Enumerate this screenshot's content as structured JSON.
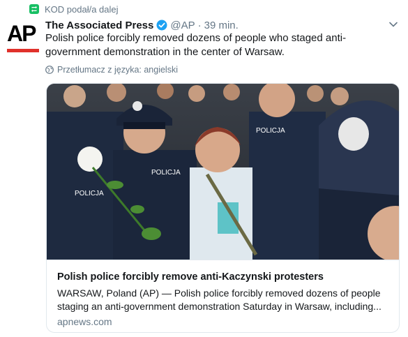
{
  "retweet": {
    "label": "KOD podał/a dalej",
    "icon": "retweet-icon",
    "color": "#17bf63"
  },
  "tweet": {
    "avatar_text": "AP",
    "author_name": "The Associated Press",
    "verified_icon": "verified-badge-icon",
    "handle": "@AP",
    "separator": "·",
    "time": "39 min.",
    "caret_icon": "chevron-down-icon",
    "text": "Polish police forcibly removed dozens of people who staged anti-government demonstration in the center of Warsaw.",
    "translate_label": "Przetłumacz z języka: angielski",
    "translate_icon": "globe-icon"
  },
  "card": {
    "image_icon": "news-photo",
    "title": "Polish police forcibly remove anti-Kaczynski protesters",
    "description": "WARSAW, Poland (AP) — Polish police forcibly removed dozens of people staging an anti-government demonstration Saturday in Warsaw, including...",
    "domain": "apnews.com"
  },
  "colors": {
    "text_primary": "#14171a",
    "text_secondary": "#657786",
    "verified_blue": "#1da1f2",
    "ap_red": "#e0312b",
    "border": "#e1e8ed"
  }
}
